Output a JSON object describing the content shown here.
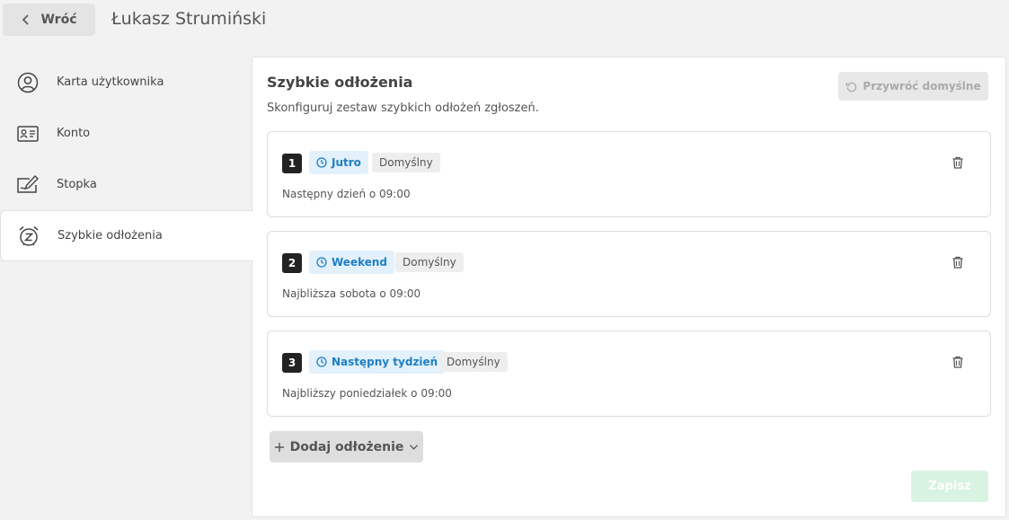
{
  "header": {
    "back_label": "Wróć",
    "user_name": "Łukasz Strumiński"
  },
  "sidebar": {
    "items": [
      {
        "label": "Karta użytkownika",
        "icon": "user-circle-icon"
      },
      {
        "label": "Konto",
        "icon": "id-card-icon"
      },
      {
        "label": "Stopka",
        "icon": "signature-pen-icon"
      },
      {
        "label": "Szybkie odłożenia",
        "icon": "snooze-alarm-icon",
        "active": true
      }
    ]
  },
  "panel": {
    "title": "Szybkie odłożenia",
    "subtitle": "Skonfiguruj zestaw szybkich odłożeń zgłoszeń.",
    "restore_label": "Przywróć domyślne",
    "snoozes": [
      {
        "number": "1",
        "name": "Jutro",
        "badge": "Domyślny",
        "description": "Następny dzień o 09:00"
      },
      {
        "number": "2",
        "name": "Weekend",
        "badge": "Domyślny",
        "description": "Najbliższa sobota o 09:00"
      },
      {
        "number": "3",
        "name": "Następny tydzień",
        "badge": "Domyślny",
        "description": "Najbliższy poniedziałek o 09:00"
      }
    ],
    "add_label": "Dodaj odłożenie",
    "save_label": "Zapisz"
  },
  "colors": {
    "accent_blue": "#1f7fc4",
    "chip_blue_bg": "#e3f1fc",
    "save_disabled": "#d9f3e2"
  }
}
